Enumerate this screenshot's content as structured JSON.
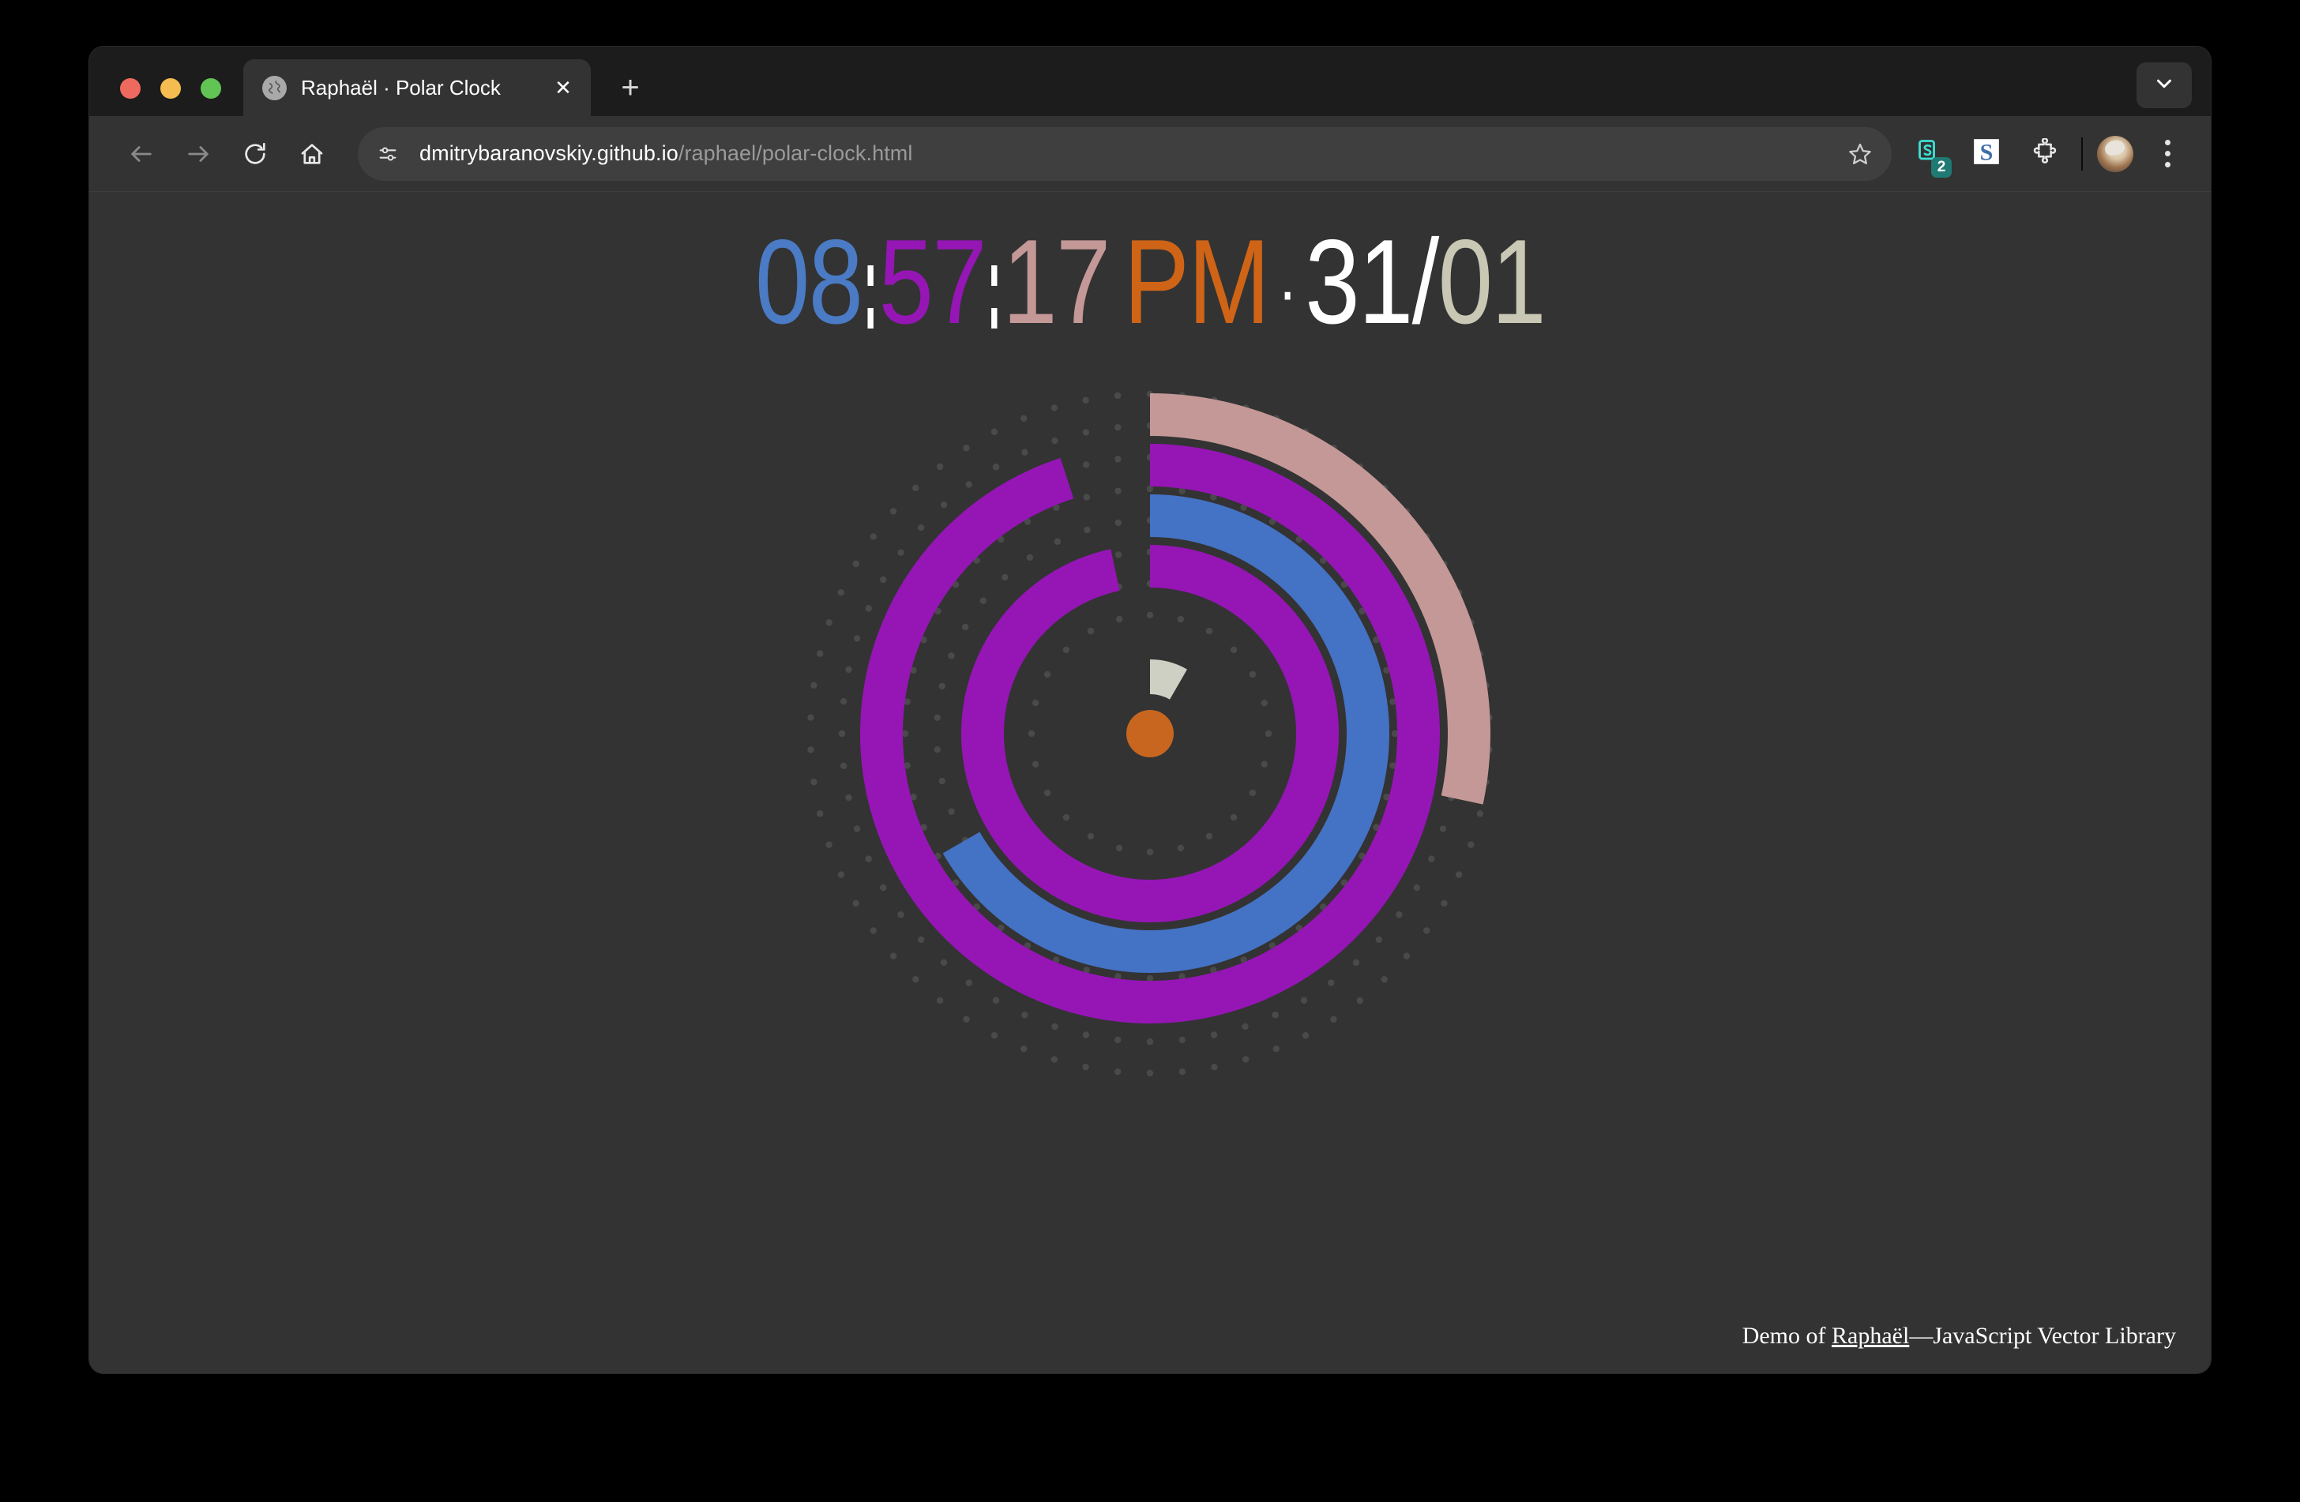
{
  "window": {
    "traffic_lights": [
      "close",
      "minimize",
      "maximize"
    ]
  },
  "tabstrip": {
    "tab": {
      "favicon": "globe-icon",
      "title": "Raphaël · Polar Clock",
      "close_label": "✕"
    },
    "new_tab_label": "+",
    "tab_list_label": "chevron-down-icon"
  },
  "toolbar": {
    "back_label": "back-arrow-icon",
    "forward_label": "forward-arrow-icon",
    "reload_label": "reload-icon",
    "home_label": "home-icon",
    "site_info_label": "tune-icon",
    "url_host": "dmitrybaranovskiy.github.io",
    "url_path": "/raphael/polar-clock.html",
    "bookmark_label": "star-icon",
    "extension_badge_count": "2",
    "extensions_puzzle_label": "puzzle-icon",
    "profile_label": "avatar",
    "menu_label": "three-dot-menu-icon"
  },
  "page": {
    "readout": {
      "hours": "08",
      "minutes": "57",
      "seconds": "17",
      "ampm": "PM",
      "separator_dot": "·",
      "day": "31",
      "date_slash": "/",
      "month": "01"
    },
    "colors": {
      "background": "#333333",
      "hours": "#4a7bc4",
      "minutes": "#9516b5",
      "seconds": "#c49897",
      "ampm": "#cf6417",
      "day": "#ffffff",
      "month": "#c8c8b4",
      "month_ring": "#cdd0c3",
      "center_dot": "#c8661f",
      "tick_dot": "#4a4a4a"
    },
    "rings": [
      {
        "name": "seconds",
        "value": 17,
        "max": 60,
        "degrees": 102,
        "color": "#c49897",
        "radius": 404,
        "width": 54
      },
      {
        "name": "minutes",
        "value": 57,
        "max": 60,
        "degrees": 342,
        "color": "#9516b5",
        "radius": 340,
        "width": 54
      },
      {
        "name": "hours",
        "value": 8,
        "max": 12,
        "degrees": 240,
        "color": "#4472c4",
        "radius": 276,
        "width": 54
      },
      {
        "name": "day",
        "value": 31,
        "max": 31,
        "degrees": 348,
        "color": "#9516b5",
        "radius": 212,
        "width": 54
      },
      {
        "name": "month",
        "value": 1,
        "max": 12,
        "degrees": 30,
        "color": "#cdd0c3",
        "radius": 72,
        "width": 44
      }
    ],
    "footer": {
      "prefix": "Demo of ",
      "link": "Raphaël",
      "suffix": "—JavaScript Vector Library"
    }
  }
}
